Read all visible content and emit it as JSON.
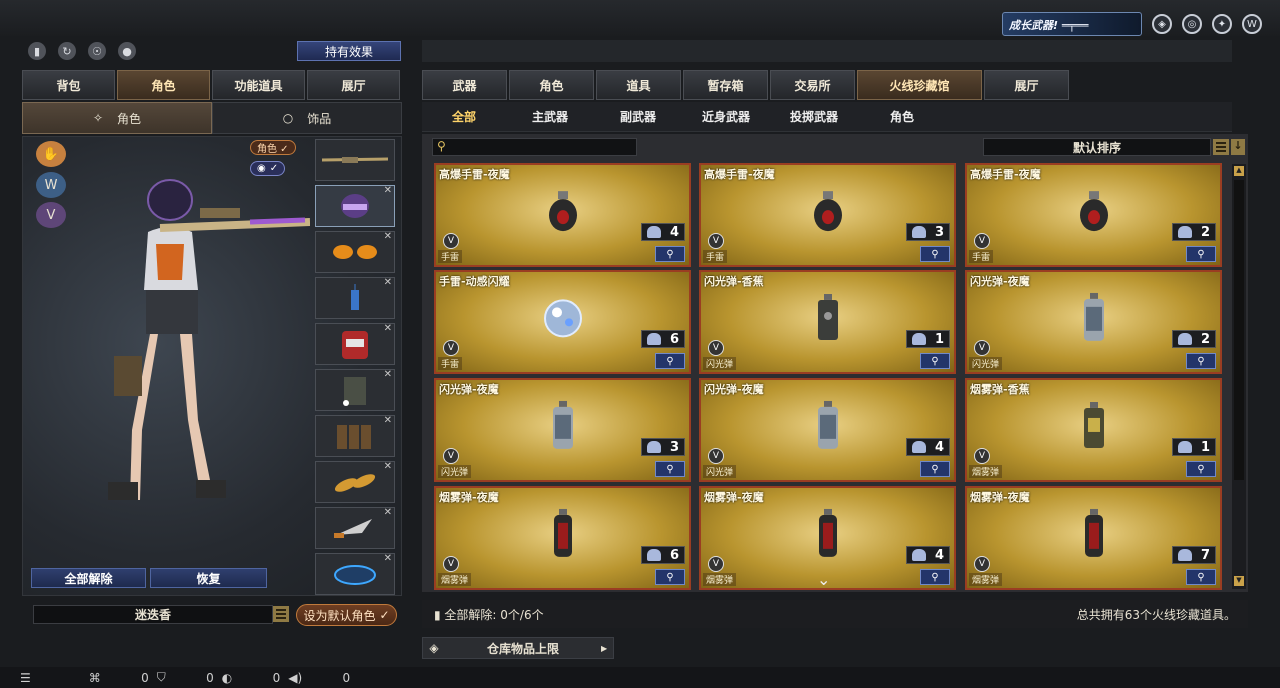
{
  "top": {
    "growth_label": "成长武器!"
  },
  "left": {
    "hold_effect_label": "持有效果",
    "tabs": [
      {
        "label": "背包"
      },
      {
        "label": "角色"
      },
      {
        "label": "功能道具"
      },
      {
        "label": "展厅"
      }
    ],
    "subtabs": [
      {
        "label": "角色"
      },
      {
        "label": "饰品"
      }
    ],
    "pill_role": "角色 ✓",
    "pill_eye": "✓",
    "unequip_all": "全部解除",
    "restore": "恢复",
    "char_name": "迷迭香",
    "set_default": "设为默认角色"
  },
  "right": {
    "tabs": [
      {
        "label": "武器"
      },
      {
        "label": "角色"
      },
      {
        "label": "道具"
      },
      {
        "label": "暂存箱"
      },
      {
        "label": "交易所"
      },
      {
        "label": "火线珍藏馆"
      },
      {
        "label": "展厅"
      }
    ],
    "subtabs": [
      {
        "label": "全部"
      },
      {
        "label": "主武器"
      },
      {
        "label": "副武器"
      },
      {
        "label": "近身武器"
      },
      {
        "label": "投掷武器"
      },
      {
        "label": "角色"
      }
    ],
    "sort_label": "默认排序",
    "items": [
      {
        "name": "高爆手雷-夜魔",
        "count": "4",
        "tag": "手雷",
        "kind": "grenade"
      },
      {
        "name": "高爆手雷-夜魔",
        "count": "3",
        "tag": "手雷",
        "kind": "grenade"
      },
      {
        "name": "高爆手雷-夜魔",
        "count": "2",
        "tag": "手雷",
        "kind": "grenade"
      },
      {
        "name": "手雷-动感闪耀",
        "count": "6",
        "tag": "手雷",
        "kind": "disco"
      },
      {
        "name": "闪光弹-香蕉",
        "count": "1",
        "tag": "闪光弹",
        "kind": "canister-dark"
      },
      {
        "name": "闪光弹-夜魔",
        "count": "2",
        "tag": "闪光弹",
        "kind": "canister"
      },
      {
        "name": "闪光弹-夜魔",
        "count": "3",
        "tag": "闪光弹",
        "kind": "canister"
      },
      {
        "name": "闪光弹-夜魔",
        "count": "4",
        "tag": "闪光弹",
        "kind": "canister"
      },
      {
        "name": "烟雾弹-香蕉",
        "count": "1",
        "tag": "烟雾弹",
        "kind": "canister-gold"
      },
      {
        "name": "烟雾弹-夜魔",
        "count": "6",
        "tag": "烟雾弹",
        "kind": "smoke"
      },
      {
        "name": "烟雾弹-夜魔",
        "count": "4",
        "tag": "烟雾弹",
        "kind": "smoke"
      },
      {
        "name": "烟雾弹-夜魔",
        "count": "7",
        "tag": "烟雾弹",
        "kind": "smoke"
      }
    ],
    "footer_left": "全部解除: 0个/6个",
    "footer_right": "总共拥有63个火线珍藏道具。",
    "warehouse_label": "仓库物品上限"
  },
  "status": {
    "values": [
      "0",
      "0",
      "0",
      "0"
    ]
  }
}
